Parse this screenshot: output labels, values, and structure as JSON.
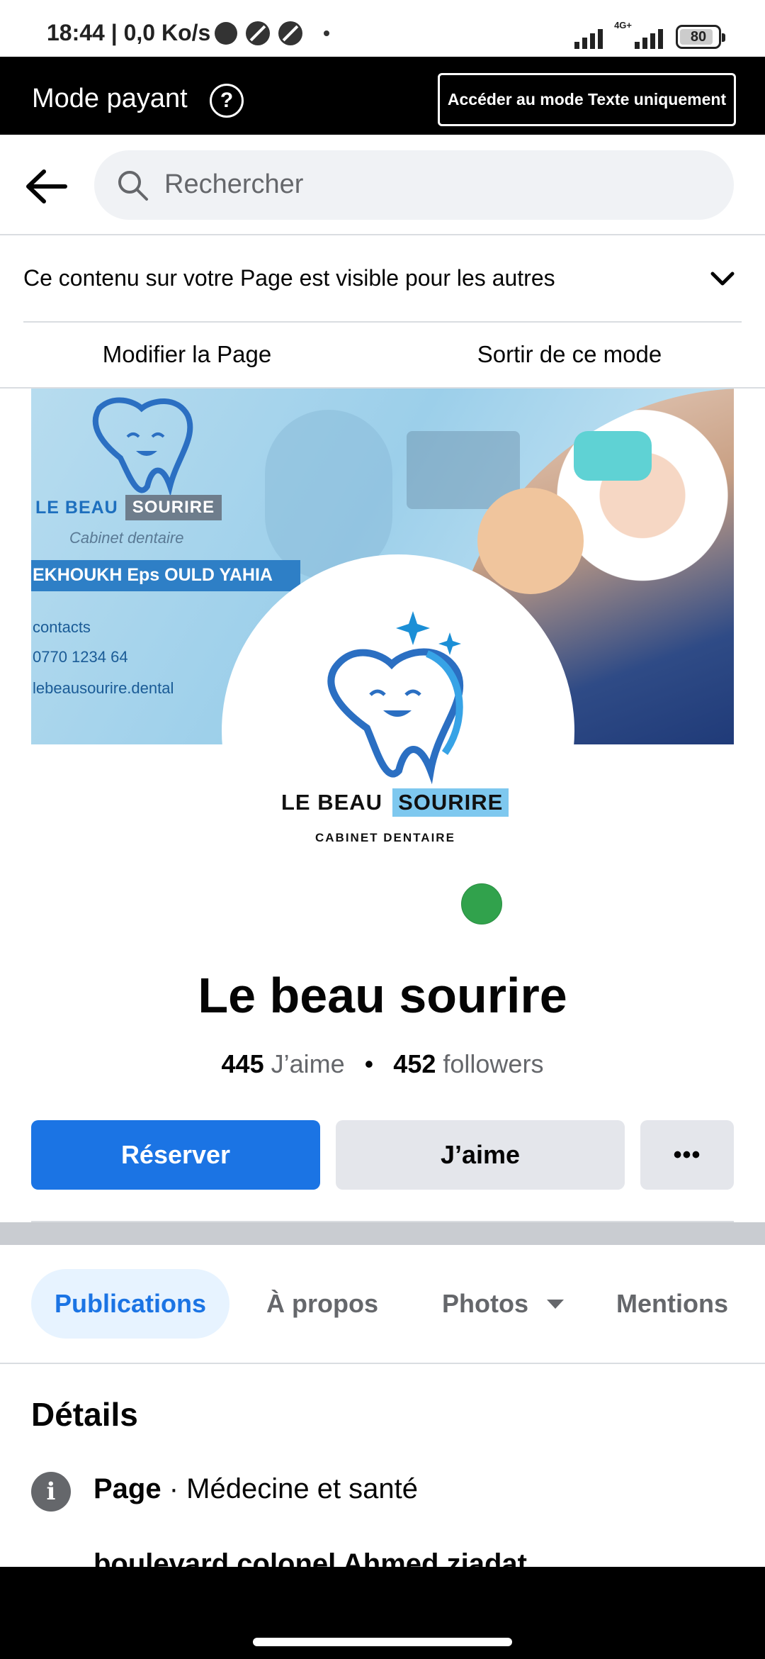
{
  "status_bar": {
    "time_speed": "18:44 | 0,0 Ko/s",
    "network": "4G+",
    "battery": "80"
  },
  "mode_bar": {
    "title": "Mode payant",
    "help_glyph": "?",
    "text_only_button": "Accéder au mode Texte uniquement"
  },
  "search": {
    "placeholder": "Rechercher"
  },
  "visibility_notice": {
    "text": "Ce contenu sur votre Page est visible pour les autres",
    "edit_page": "Modifier la Page",
    "exit_mode": "Sortir de ce mode"
  },
  "cover": {
    "brand_a": "LE BEAU",
    "brand_b": "SOURIRE",
    "subtitle": "Cabinet dentaire",
    "name_band": "EKHOUKH Eps OULD YAHIA",
    "contacts": "contacts",
    "phone": "0770 1234 64",
    "website": "lebeausourire.dental"
  },
  "profile": {
    "brand_a": "LE BEAU",
    "brand_b": "SOURIRE",
    "subtitle": "CABINET DENTAIRE"
  },
  "page": {
    "name": "Le beau sourire",
    "likes_count": "445",
    "likes_label": "J’aime",
    "separator": "•",
    "followers_count": "452",
    "followers_label": "followers"
  },
  "actions": {
    "primary": "Réserver",
    "like": "J’aime",
    "more": "•••"
  },
  "tabs": [
    {
      "label": "Publications",
      "active": true
    },
    {
      "label": "À propos",
      "active": false
    },
    {
      "label": "Photos",
      "active": false
    },
    {
      "label": "Mentions",
      "active": false
    }
  ],
  "details": {
    "title": "Détails",
    "info_glyph": "i",
    "category_bold": "Page",
    "category_rest": " · Médecine et santé",
    "address_partial": "boulevard colonel Ahmed ziadat"
  },
  "colors": {
    "accent": "#1b74e4",
    "online": "#31a24c",
    "secondary_button": "#e4e6eb"
  }
}
